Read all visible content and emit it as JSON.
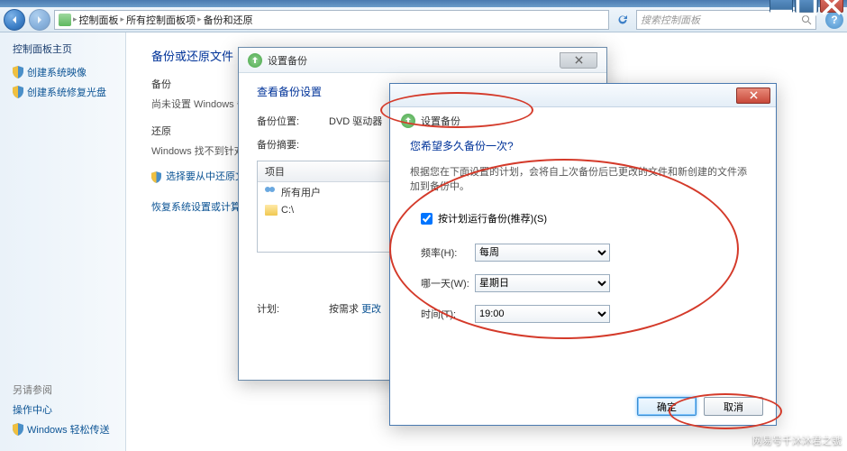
{
  "window": {
    "min": "—",
    "max": "☐",
    "close": "✕"
  },
  "breadcrumb": {
    "root": "控制面板",
    "all": "所有控制面板项",
    "here": "备份和还原"
  },
  "search": {
    "placeholder": "搜索控制面板"
  },
  "sidebar": {
    "home": "控制面板主页",
    "links": {
      "create_image": "创建系统映像",
      "create_repair": "创建系统修复光盘"
    },
    "also": "另请参阅",
    "bottom": {
      "action_center": "操作中心",
      "easy_transfer": "Windows 轻松传送"
    }
  },
  "main": {
    "title": "备份或还原文件",
    "backup_h": "备份",
    "backup_t": "尚未设置 Windows 备",
    "restore_h": "还原",
    "restore_t": "Windows 找不到针对此",
    "restore_link": "选择要从中还原文件",
    "recover_link": "恢复系统设置或计算机"
  },
  "dlg1": {
    "title": "设置备份",
    "heading": "查看备份设置",
    "loc_lbl": "备份位置:",
    "loc_val": "DVD 驱动器",
    "sum_lbl": "备份摘要:",
    "list_head": "项目",
    "list_users": "所有用户",
    "list_c": "C:\\",
    "sched_lbl": "计划:",
    "sched_val": "按需求",
    "sched_link": "更改"
  },
  "dlg2": {
    "sub": "设置备份",
    "heading": "您希望多久备份一次?",
    "desc": "根据您在下面设置的计划，会将自上次备份后已更改的文件和新创建的文件添加到备份中。",
    "chk": "按计划运行备份(推荐)(S)",
    "freq_lbl": "频率(H):",
    "freq_val": "每周",
    "day_lbl": "哪一天(W):",
    "day_val": "星期日",
    "time_lbl": "时间(T):",
    "time_val": "19:00",
    "ok": "确定",
    "cancel": "取消"
  },
  "watermark": "网易号千沐沐君之號"
}
